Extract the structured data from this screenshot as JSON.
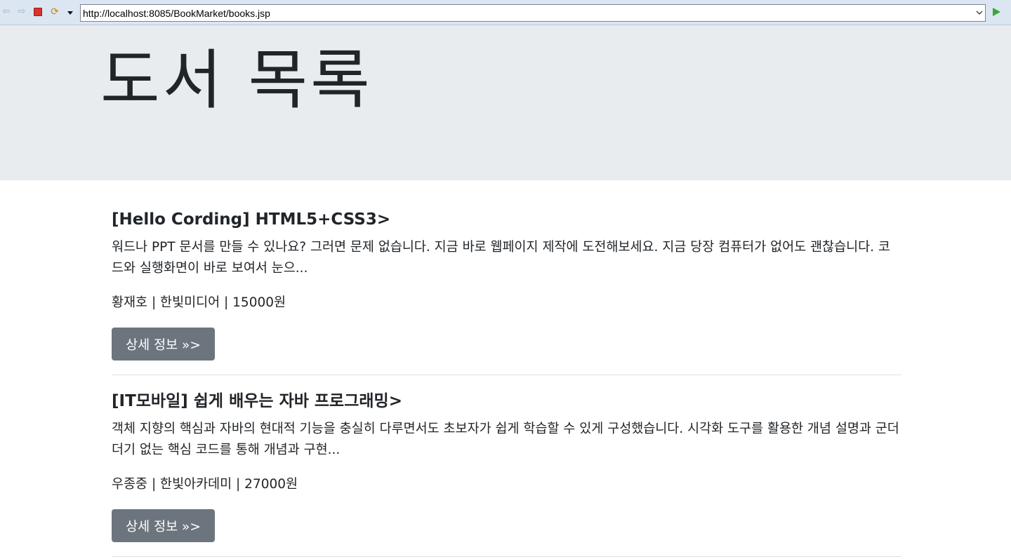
{
  "browser": {
    "url": "http://localhost:8085/BookMarket/books.jsp",
    "icons": [
      "back-arrow-icon",
      "forward-arrow-icon",
      "stop-icon",
      "refresh-icon",
      "menu-dropdown-icon",
      "url-history-chevron-icon",
      "go-icon"
    ]
  },
  "page": {
    "title": "도서 목록"
  },
  "books": [
    {
      "title": "[Hello Cording] HTML5+CSS3>",
      "description": "워드나 PPT 문서를 만들 수 있나요? 그러면 문제 없습니다. 지금 바로 웹페이지 제작에 도전해보세요. 지금 당장 컴퓨터가 없어도 괜찮습니다. 코드와 실행화면이 바로 보여서 눈으...",
      "meta": "황재호 | 한빛미디어 | 15000원",
      "button_label": "상세 정보 »>"
    },
    {
      "title": "[IT모바일] 쉽게 배우는 자바 프로그래밍>",
      "description": "객체 지향의 핵심과 자바의 현대적 기능을 충실히 다루면서도 초보자가 쉽게 학습할 수 있게 구성했습니다. 시각화 도구를 활용한 개념 설명과 군더더기 없는 핵심 코드를 통해 개념과 구현...",
      "meta": "우종중 | 한빛아카데미 | 27000원",
      "button_label": "상세 정보 »>"
    }
  ],
  "colors": {
    "toolbar_bg": "#dce6f2",
    "jumbotron_bg": "#e9ecef",
    "button_bg": "#6c757d",
    "text": "#212529",
    "divider": "#dee2e6"
  }
}
